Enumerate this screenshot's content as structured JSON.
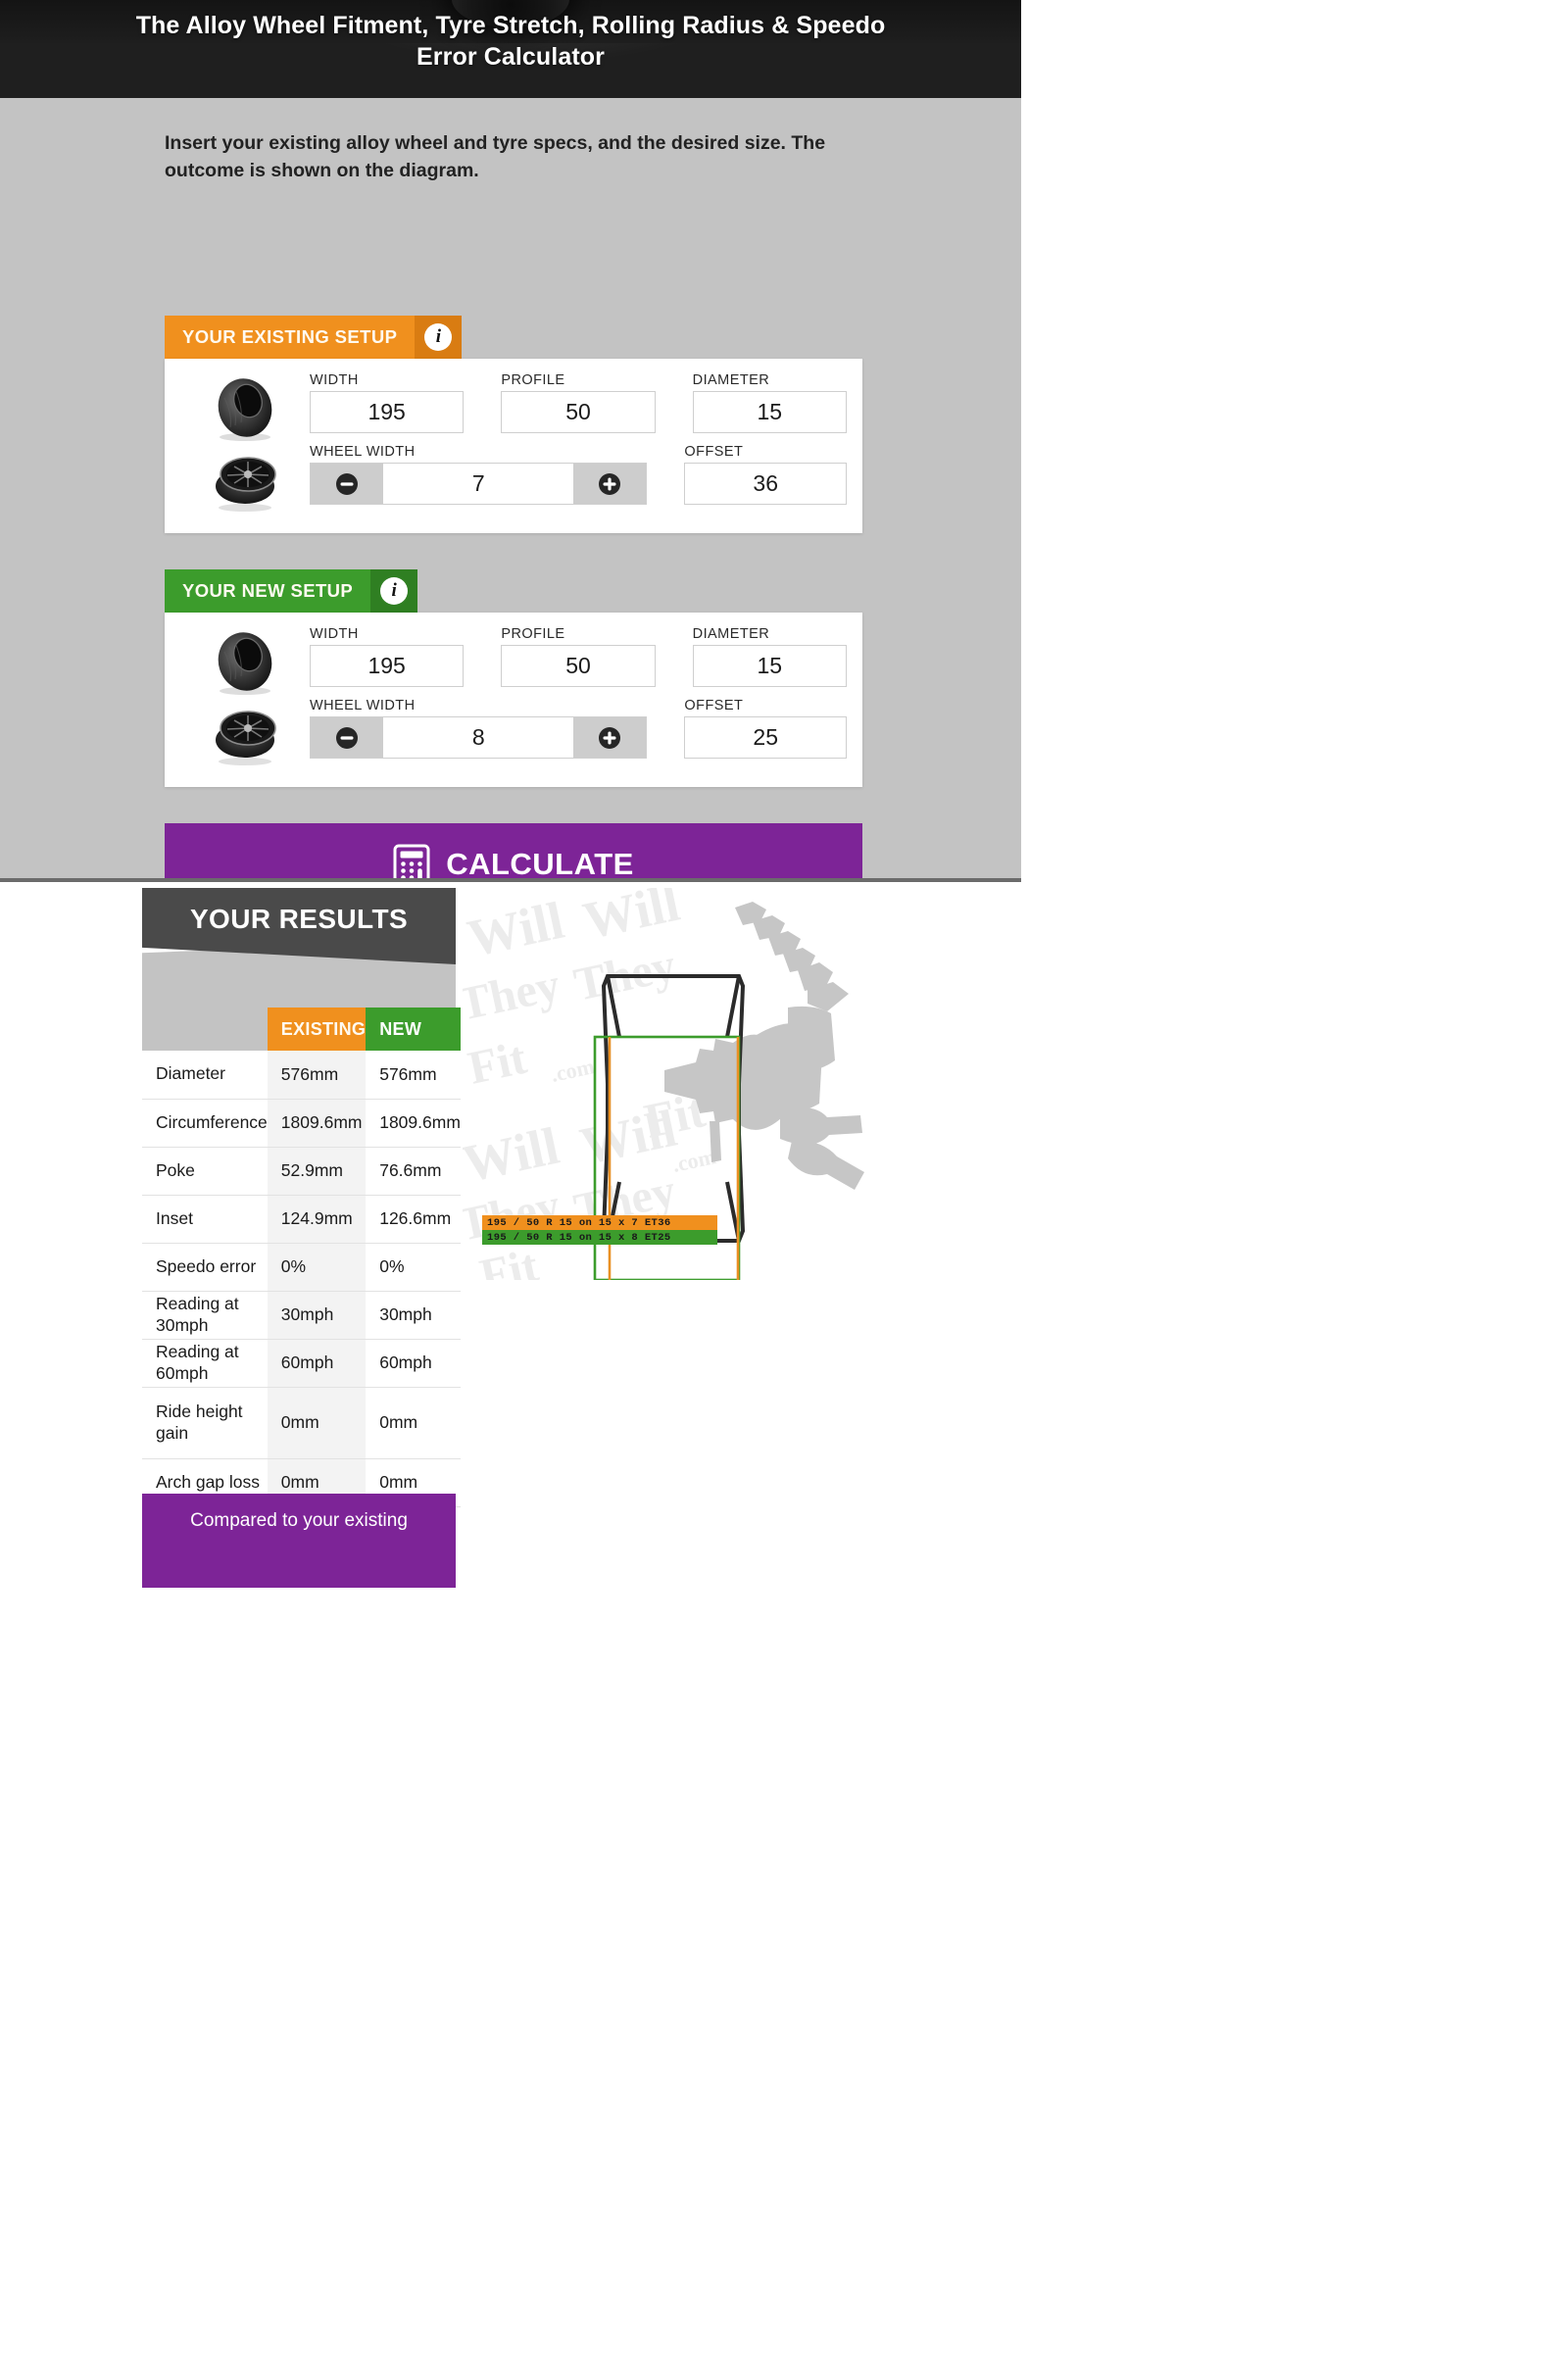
{
  "header": {
    "title": "The Alloy Wheel Fitment, Tyre Stretch, Rolling Radius & Speedo Error Calculator"
  },
  "intro": "Insert your existing alloy wheel and tyre specs, and the desired size. The outcome is shown on the diagram.",
  "existing_setup": {
    "header_label": "YOUR EXISTING SETUP",
    "info_icon": "info-icon",
    "labels": {
      "width": "WIDTH",
      "profile": "PROFILE",
      "diameter": "DIAMETER",
      "wheel_width": "WHEEL WIDTH",
      "offset": "OFFSET"
    },
    "values": {
      "width": "195",
      "profile": "50",
      "diameter": "15",
      "wheel_width": "7",
      "offset": "36"
    },
    "stepper": {
      "minus": "minus-circle-icon",
      "plus": "plus-circle-icon"
    }
  },
  "new_setup": {
    "header_label": "YOUR NEW SETUP",
    "info_icon": "info-icon",
    "labels": {
      "width": "WIDTH",
      "profile": "PROFILE",
      "diameter": "DIAMETER",
      "wheel_width": "WHEEL WIDTH",
      "offset": "OFFSET"
    },
    "values": {
      "width": "195",
      "profile": "50",
      "diameter": "15",
      "wheel_width": "8",
      "offset": "25"
    },
    "stepper": {
      "minus": "minus-circle-icon",
      "plus": "plus-circle-icon"
    }
  },
  "calculate": {
    "label": "CALCULATE",
    "icon": "calculator-icon"
  },
  "results": {
    "banner": "YOUR RESULTS",
    "columns": {
      "blank": "",
      "existing": "EXISTING",
      "new": "NEW"
    },
    "rows": [
      {
        "label": "Diameter",
        "existing": "576mm",
        "new": "576mm"
      },
      {
        "label": "Circumference",
        "existing": "1809.6mm",
        "new": "1809.6mm"
      },
      {
        "label": "Poke",
        "existing": "52.9mm",
        "new": "76.6mm"
      },
      {
        "label": "Inset",
        "existing": "124.9mm",
        "new": "126.6mm"
      },
      {
        "label": "Speedo error",
        "existing": "0%",
        "new": "0%"
      },
      {
        "label": "Reading at 30mph",
        "existing": "30mph",
        "new": "30mph"
      },
      {
        "label": "Reading at 60mph",
        "existing": "60mph",
        "new": "60mph"
      },
      {
        "label": "Ride height gain",
        "existing": "0mm",
        "new": "0mm"
      },
      {
        "label": "Arch gap loss",
        "existing": "0mm",
        "new": "0mm"
      }
    ],
    "compare_text": "Compared to your existing"
  },
  "diagram": {
    "watermark": "WillTheyFit.com",
    "legend_existing": "195 / 50 R 15 on 15 x 7 ET36",
    "legend_new": "195 / 50 R 15 on 15 x 8 ET25"
  },
  "colors": {
    "orange": "#f0901e",
    "green": "#3c9c2c",
    "purple": "#7d2497",
    "dark": "#4a4a4a"
  }
}
